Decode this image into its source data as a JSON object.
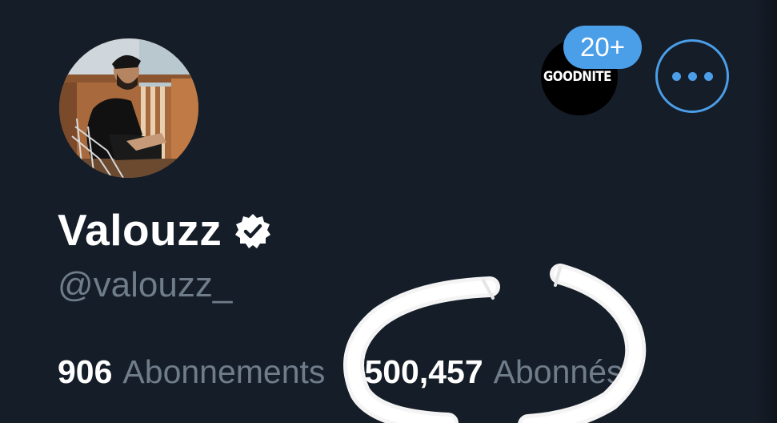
{
  "profile": {
    "display_name": "Valouzz",
    "handle": "@valouzz_",
    "verified": true
  },
  "community": {
    "logo_text": "GOODNITE",
    "count_label": "20+"
  },
  "stats": {
    "following_count": "906",
    "following_label": "Abonnements",
    "followers_count": "500,457",
    "followers_label": "Abonnés"
  },
  "colors": {
    "background": "#151d28",
    "accent": "#4b9ee8",
    "secondary_text": "#6f7c89",
    "primary_text": "#ffffff"
  },
  "icons": {
    "more": "more-horizontal-icon",
    "verified": "verified-badge-icon"
  }
}
